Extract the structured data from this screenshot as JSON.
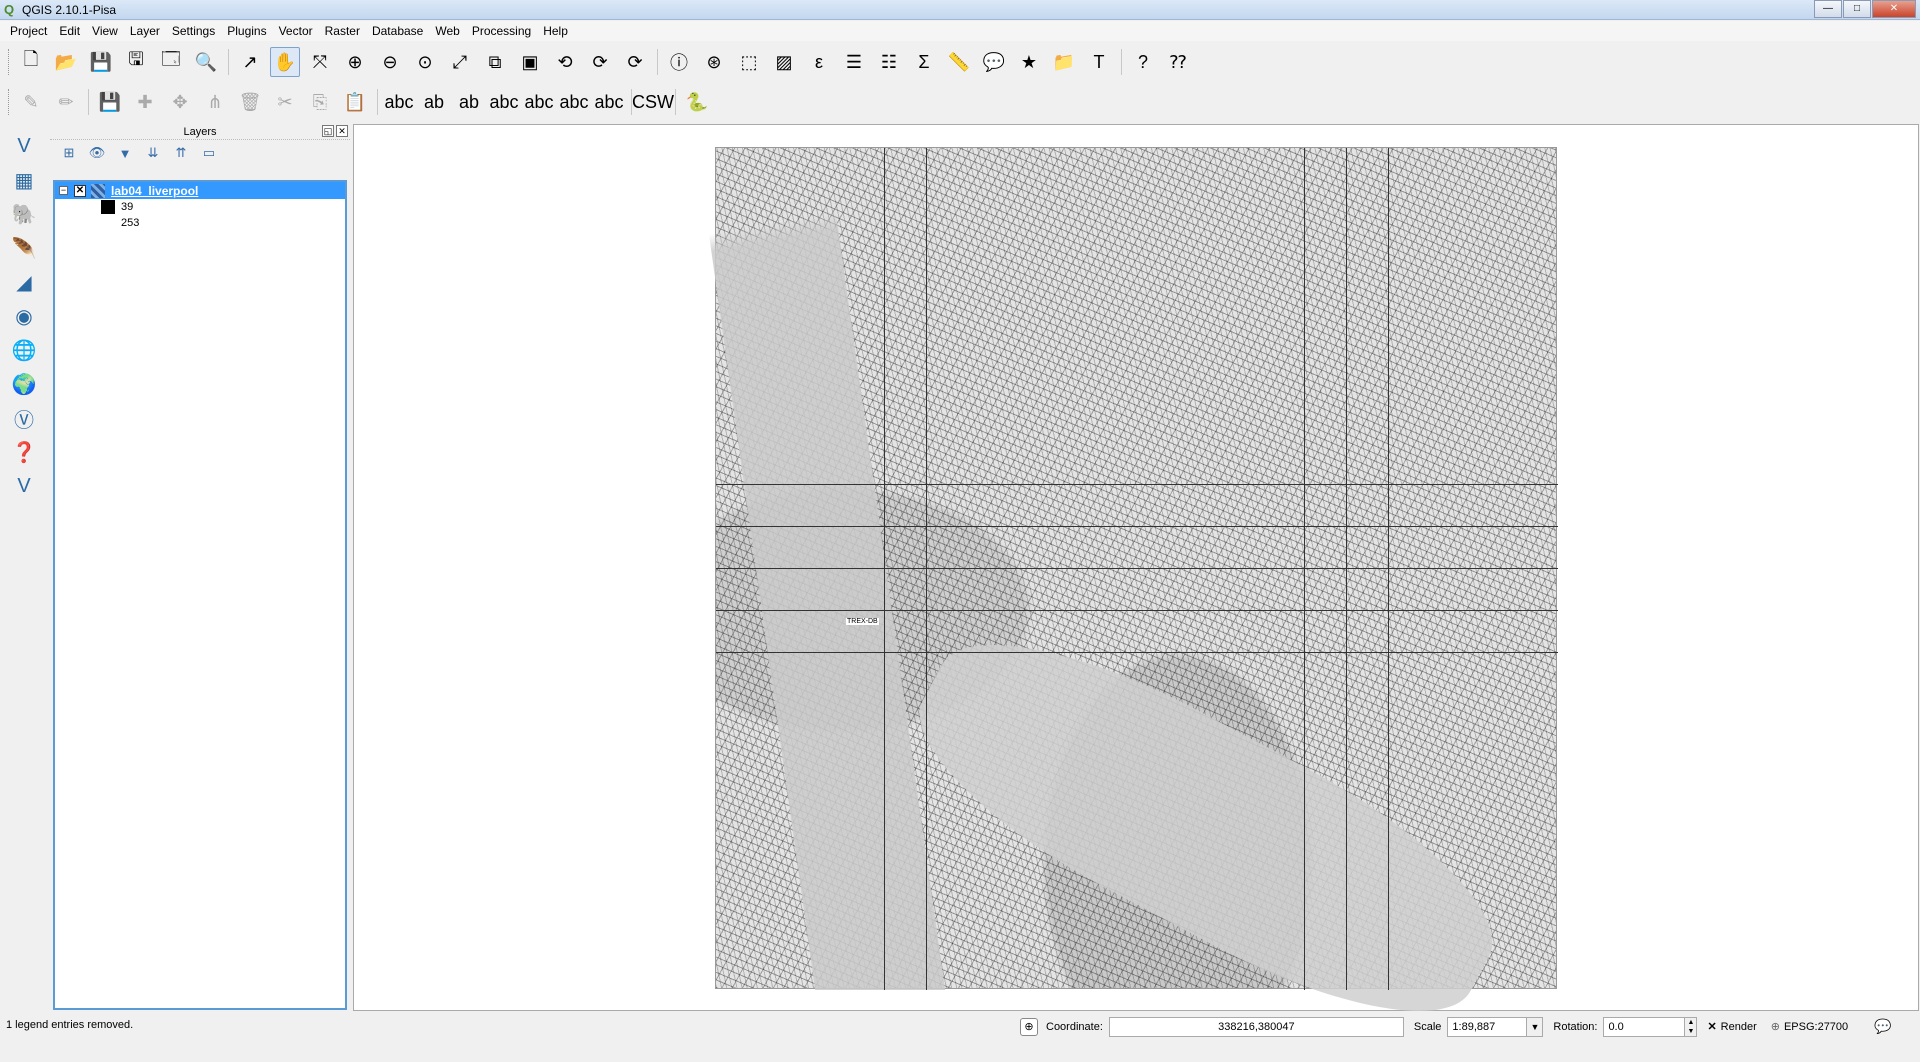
{
  "window": {
    "title": "QGIS 2.10.1-Pisa",
    "minimize": "—",
    "maximize": "□",
    "close": "✕",
    "app_icon": "Q"
  },
  "menu": [
    "Project",
    "Edit",
    "View",
    "Layer",
    "Settings",
    "Plugins",
    "Vector",
    "Raster",
    "Database",
    "Web",
    "Processing",
    "Help"
  ],
  "toolbar1": {
    "icons": [
      "new-project-icon",
      "open-project-icon",
      "save-project-icon",
      "save-as-icon",
      "new-print-composer-icon",
      "composer-manager-icon",
      "pan-to-selection-icon",
      "pan-icon",
      "pan-map-icon",
      "zoom-in-icon",
      "zoom-out-icon",
      "zoom-native-icon",
      "zoom-full-icon",
      "zoom-selection-icon",
      "zoom-layer-icon",
      "zoom-last-icon",
      "zoom-next-icon",
      "refresh-icon",
      "identify-icon",
      "select-icon",
      "select-feature-icon",
      "deselect-icon",
      "expression-select-icon",
      "attribute-table-icon",
      "field-calculator-icon",
      "statistics-icon",
      "measure-icon",
      "map-tips-icon",
      "new-bookmark-icon",
      "show-bookmarks-icon",
      "text-annotation-icon",
      "help-icon",
      "whats-this-icon"
    ],
    "glyphs": [
      "🗋",
      "📂",
      "💾",
      "🖫",
      "🗔",
      "🔍",
      "↗",
      "✋",
      "⤧",
      "⊕",
      "⊖",
      "⊙",
      "⤢",
      "⧉",
      "▣",
      "⟲",
      "⟳",
      "⟳",
      "ⓘ",
      "⊛",
      "⬚",
      "▨",
      "ε",
      "☰",
      "☷",
      "Σ",
      "📏",
      "💬",
      "★",
      "📁",
      "T",
      "?",
      "⁇"
    ]
  },
  "toolbar2": {
    "icons": [
      "current-edits-icon",
      "toggle-editing-icon",
      "save-edits-icon",
      "add-feature-icon",
      "move-feature-icon",
      "node-tool-icon",
      "delete-selected-icon",
      "cut-features-icon",
      "copy-features-icon",
      "paste-features-icon",
      "label-icon",
      "layer-labeling-icon",
      "pin-labels-icon",
      "show-hide-labels-icon",
      "move-label-icon",
      "rotate-label-icon",
      "change-label-icon",
      "csw-icon",
      "python-console-icon"
    ],
    "glyphs": [
      "✎",
      "✏",
      "💾",
      "✚",
      "✥",
      "⋔",
      "🗑",
      "✂",
      "⎘",
      "📋",
      "abc",
      "ab",
      "ab",
      "abc",
      "abc",
      "abc",
      "abc",
      "CSW",
      "🐍"
    ]
  },
  "left_toolbar": {
    "icons": [
      "add-vector-layer-icon",
      "add-raster-layer-icon",
      "add-postgis-layer-icon",
      "add-spatialite-layer-icon",
      "add-mssql-layer-icon",
      "add-oracle-layer-icon",
      "add-wms-layer-icon",
      "add-wcs-layer-icon",
      "add-wfs-layer-icon",
      "add-delimited-text-icon",
      "new-layer-icon"
    ],
    "glyphs": [
      "V",
      "▦",
      "🐘",
      "🪶",
      "◢",
      "◉",
      "🌐",
      "🌍",
      "Ⓥ",
      "❓",
      "V"
    ]
  },
  "layers_panel": {
    "title": "Layers",
    "float_btn": "◱",
    "close_btn": "✕",
    "tool_glyphs": [
      "⊞",
      "👁",
      "▼",
      "⇊",
      "⇈",
      "▭"
    ],
    "layer": {
      "name": "lab04_liverpool",
      "expand": "−",
      "checked": "✕"
    },
    "legend": [
      {
        "label": "39",
        "color": "#000000"
      },
      {
        "label": "253",
        "color": "#ffffff"
      }
    ]
  },
  "map": {
    "label": "TREX-DB"
  },
  "status": {
    "message": "1 legend entries removed.",
    "coord_icon": "⊕",
    "coordinate_label": "Coordinate:",
    "coordinate_value": "338216,380047",
    "scale_label": "Scale",
    "scale_value": "1:89,887",
    "rotation_label": "Rotation:",
    "rotation_value": "0.0",
    "render_check": "✕",
    "render_label": "Render",
    "epsg_icon": "⊕",
    "crs": "EPSG:27700",
    "messages_icon": "💬"
  }
}
